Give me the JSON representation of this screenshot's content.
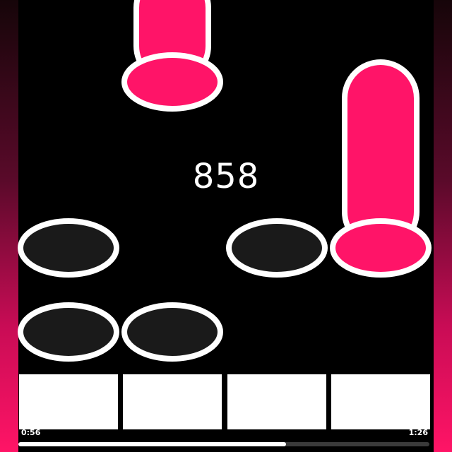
{
  "game": {
    "score": "858",
    "colors": {
      "note": "#ff1468",
      "outline": "#ffffff",
      "hole": "#1a1a1a",
      "background": "#000000",
      "tile": "#ffffff",
      "edge_glow": "#ff1466"
    },
    "holes": [
      {
        "lane": 0,
        "row": "upper"
      },
      {
        "lane": 2,
        "row": "upper"
      },
      {
        "lane": 0,
        "row": "lower"
      },
      {
        "lane": 1,
        "row": "lower"
      }
    ],
    "long_notes": [
      {
        "lane": 1,
        "state": "falling"
      },
      {
        "lane": 3,
        "state": "active"
      }
    ],
    "tap_tiles": [
      {
        "lane": 0
      },
      {
        "lane": 1
      },
      {
        "lane": 2
      },
      {
        "lane": 3
      }
    ]
  },
  "playback": {
    "elapsed": "0:56",
    "total": "1:26",
    "progress_fraction": 0.651
  }
}
